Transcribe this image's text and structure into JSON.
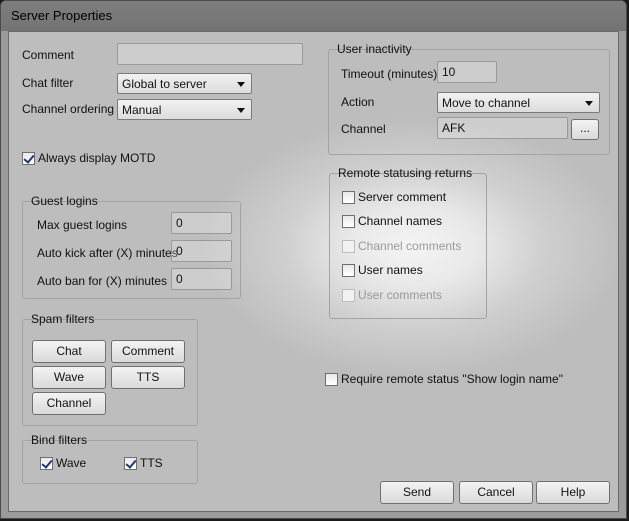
{
  "window": {
    "title": "Server Properties"
  },
  "general": {
    "comment_label": "Comment",
    "comment_value": "",
    "chat_filter_label": "Chat filter",
    "chat_filter_value": "Global to server",
    "channel_ordering_label": "Channel ordering",
    "channel_ordering_value": "Manual",
    "always_motd_label": "Always display MOTD",
    "always_motd_checked": true
  },
  "guest_logins": {
    "legend": "Guest logins",
    "max_label": "Max guest logins",
    "max_value": "0",
    "kick_label": "Auto kick after (X) minutes",
    "kick_value": "0",
    "ban_label": "Auto ban for (X) minutes",
    "ban_value": "0"
  },
  "spam_filters": {
    "legend": "Spam filters",
    "chat": "Chat",
    "comment": "Comment",
    "wave": "Wave",
    "tts": "TTS",
    "channel": "Channel"
  },
  "bind_filters": {
    "legend": "Bind filters",
    "wave_label": "Wave",
    "wave_checked": true,
    "tts_label": "TTS",
    "tts_checked": true
  },
  "user_inactivity": {
    "legend": "User inactivity",
    "timeout_label": "Timeout (minutes)",
    "timeout_value": "10",
    "action_label": "Action",
    "action_value": "Move to channel",
    "channel_label": "Channel",
    "channel_value": "AFK",
    "browse_label": "..."
  },
  "remote_statusing": {
    "legend": "Remote statusing returns",
    "items": [
      {
        "label": "Server comment",
        "checked": false,
        "enabled": true
      },
      {
        "label": "Channel names",
        "checked": false,
        "enabled": true
      },
      {
        "label": "Channel comments",
        "checked": false,
        "enabled": false
      },
      {
        "label": "User names",
        "checked": false,
        "enabled": true
      },
      {
        "label": "User comments",
        "checked": false,
        "enabled": false
      }
    ]
  },
  "require_remote": {
    "label": "Require remote status \"Show login name\"",
    "checked": false
  },
  "footer": {
    "send": "Send",
    "cancel": "Cancel",
    "help": "Help"
  }
}
